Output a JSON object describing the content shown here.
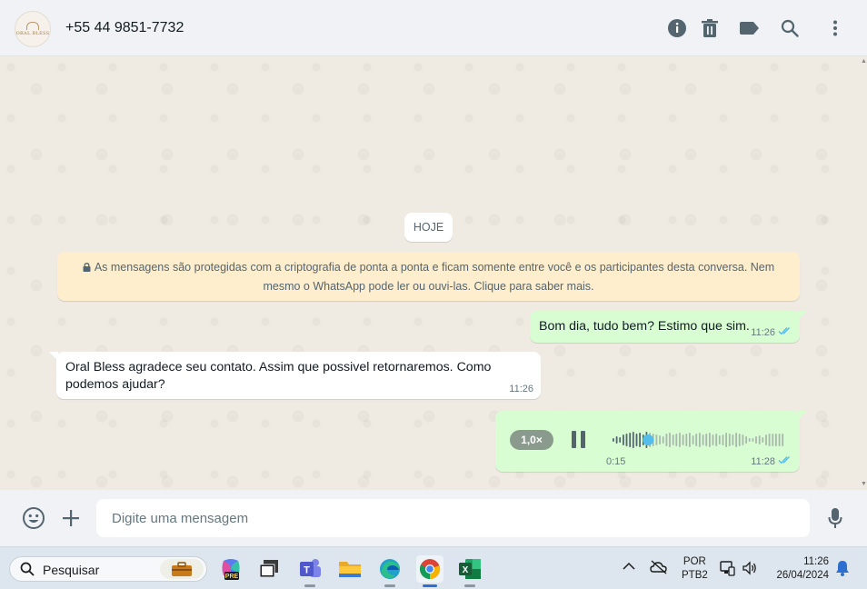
{
  "header": {
    "avatar_text": "ORAL BLESS",
    "contact_name": "+55 44 9851-7732",
    "icons": [
      "info-icon",
      "trash-icon",
      "label-icon",
      "search-icon",
      "more-vertical-icon"
    ]
  },
  "chat": {
    "date_chip": "HOJE",
    "encryption_notice": "As mensagens são protegidas com a criptografia de ponta a ponta e ficam somente entre você e os participantes desta conversa. Nem mesmo o WhatsApp pode ler ou ouvi-las. Clique para saber mais.",
    "messages": [
      {
        "direction": "outgoing",
        "text": "Bom dia, tudo bem? Estimo que sim.",
        "time": "11:26",
        "status": "read"
      },
      {
        "direction": "incoming",
        "text": "Oral Bless agradece seu contato. Assim que possivel retornaremos. Como podemos ajudar?",
        "time": "11:26"
      },
      {
        "direction": "outgoing",
        "type": "voice",
        "speed": "1,0×",
        "duration": "0:15",
        "time": "11:28",
        "status": "read",
        "progress": 0.22
      }
    ]
  },
  "composer": {
    "placeholder": "Digite uma mensagem",
    "icons": [
      "emoji-icon",
      "plus-icon",
      "microphone-icon"
    ]
  },
  "taskbar": {
    "search_label": "Pesquisar",
    "apps": [
      "briefcase-icon",
      "copilot-pre-icon",
      "task-view-icon",
      "teams-icon",
      "file-explorer-icon",
      "edge-icon",
      "chrome-icon",
      "excel-icon"
    ],
    "copilot_badge": "PRE",
    "teams_letter": "T",
    "excel_letter": "X",
    "language": "POR",
    "keyboard": "PTB2",
    "time": "11:26",
    "date": "26/04/2024"
  },
  "colors": {
    "outgoing_bubble": "#d9fdd3",
    "incoming_bubble": "#ffffff",
    "notice_bg": "#ffeecd",
    "read_ticks": "#53bdeb",
    "chat_bg": "#efeae2"
  }
}
